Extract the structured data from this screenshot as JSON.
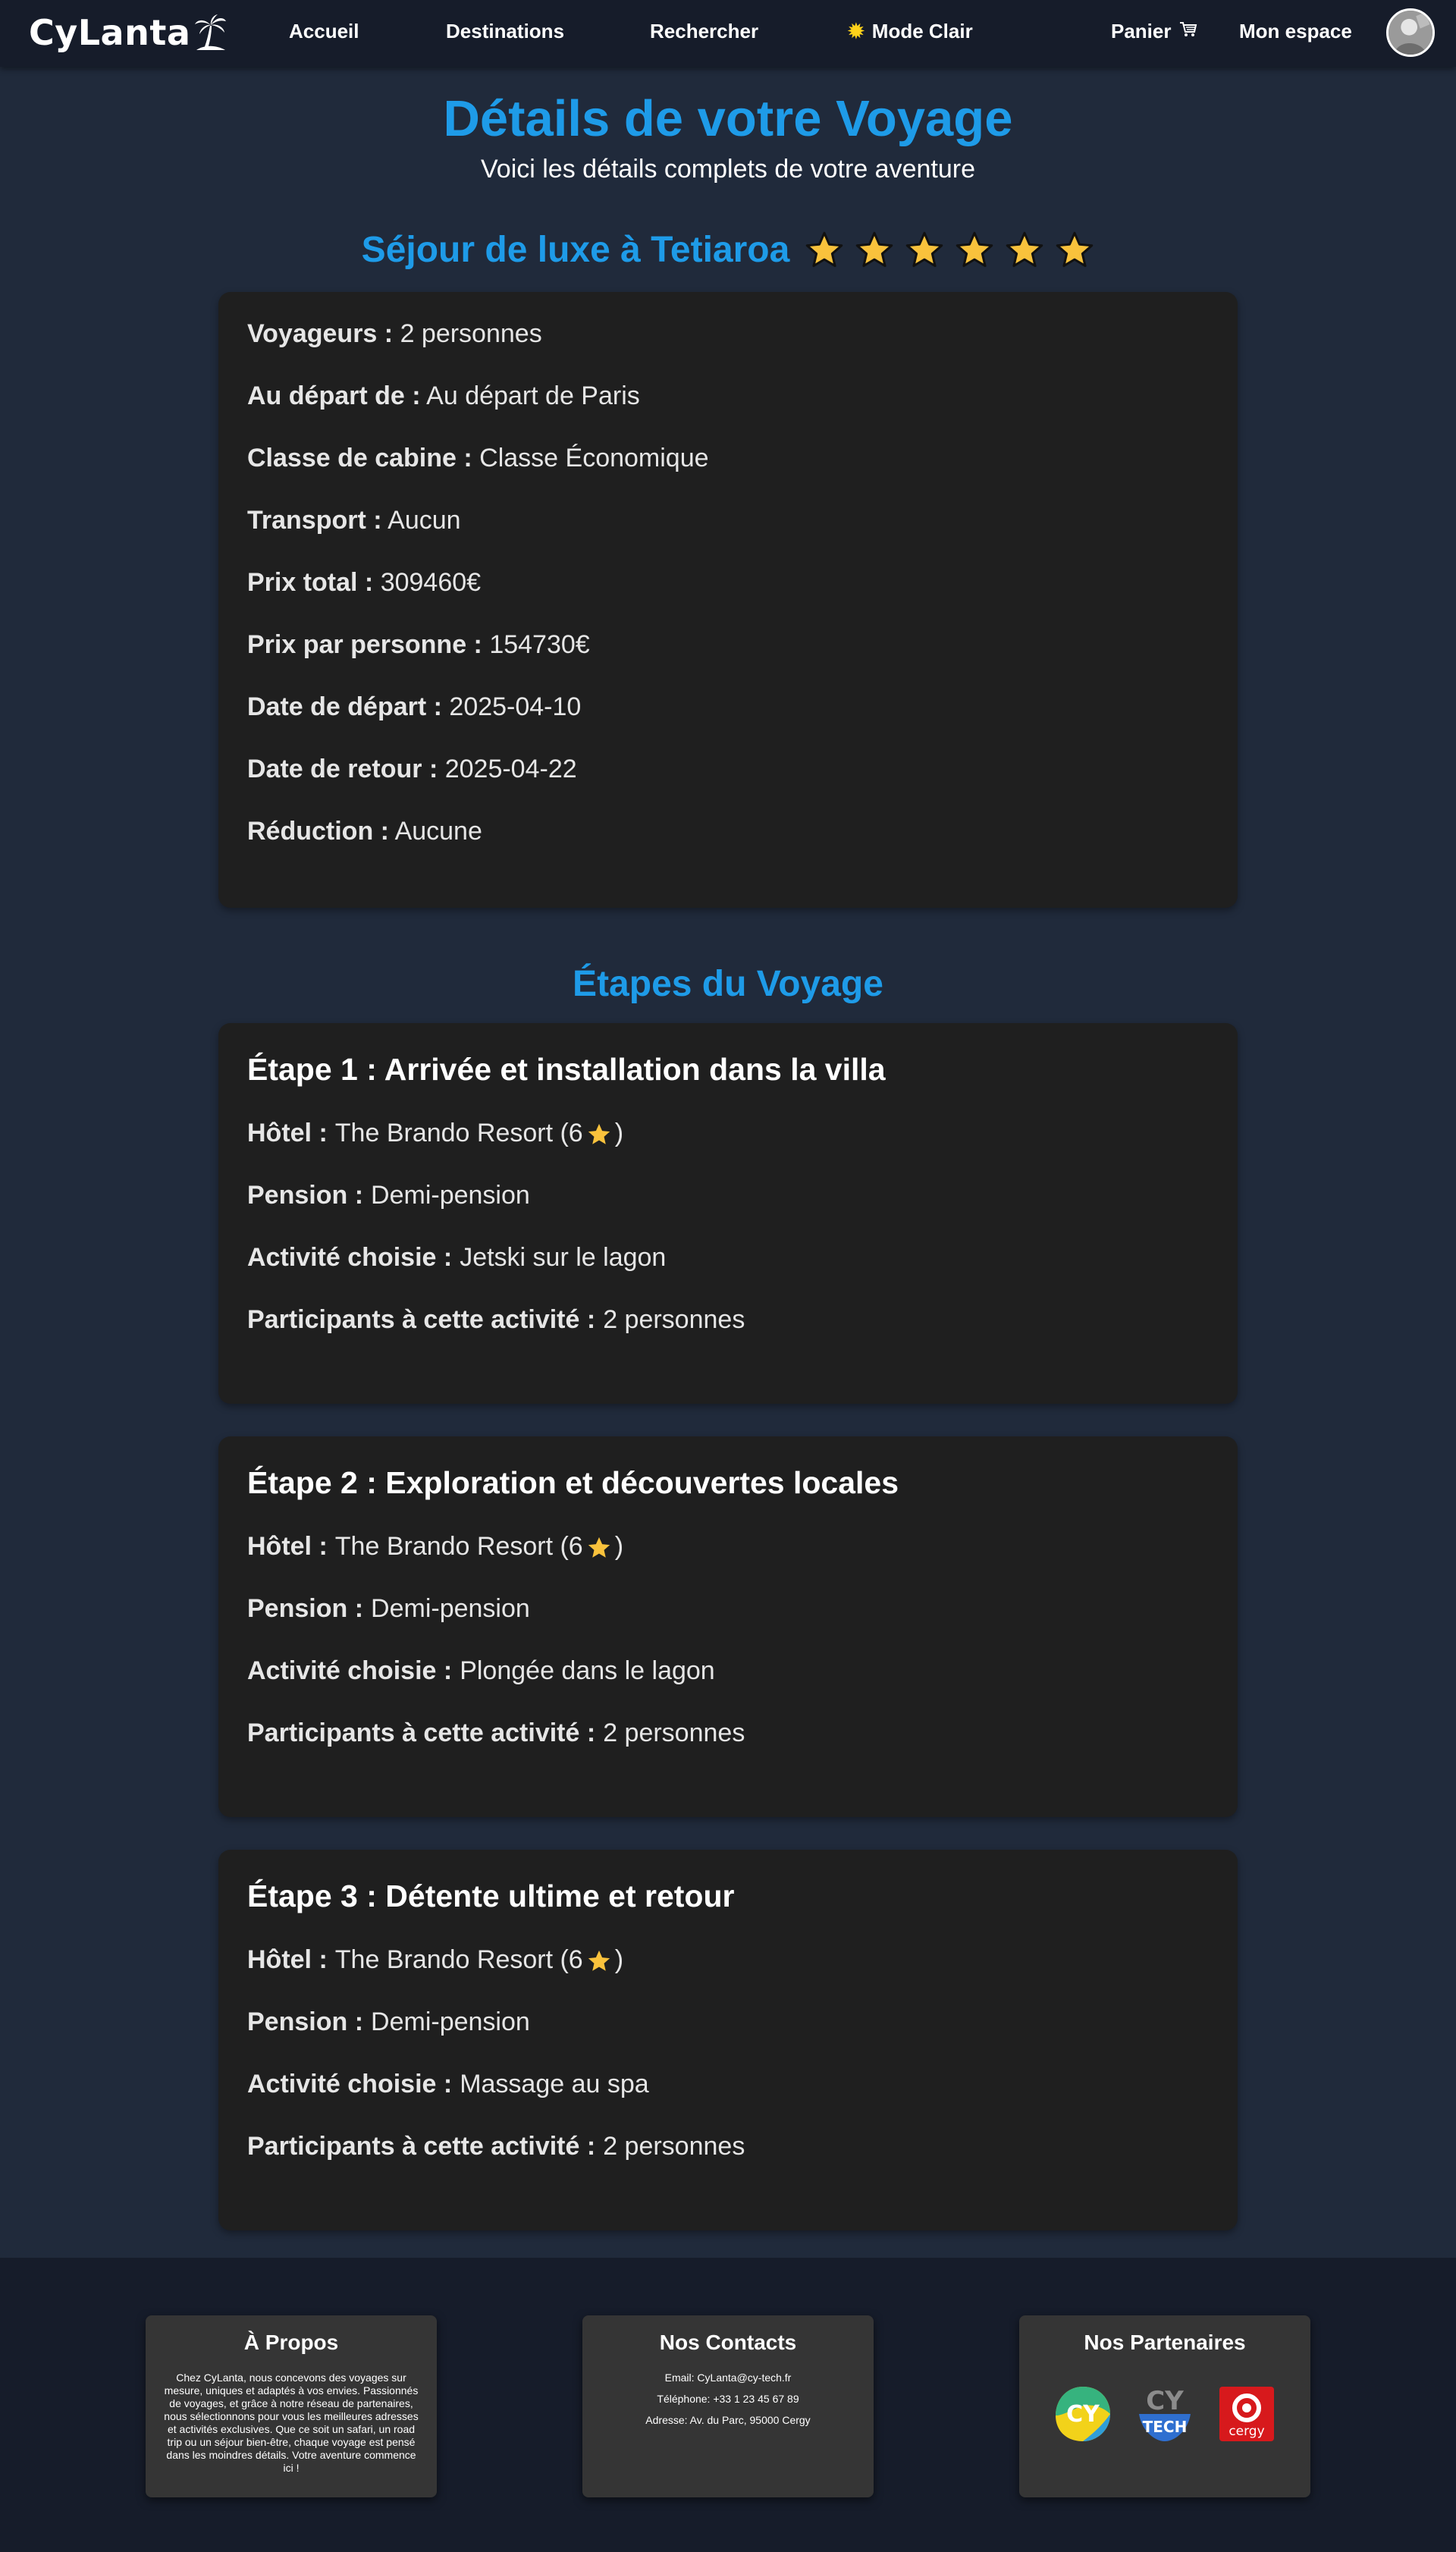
{
  "nav": {
    "brand": "CyLanta",
    "links": {
      "home": "Accueil",
      "destinations": "Destinations",
      "search": "Rechercher",
      "mode": "Mode Clair",
      "cart": "Panier",
      "account": "Mon espace"
    },
    "icons": {
      "brand": "palm-tree-icon",
      "mode": "sun-icon",
      "cart": "cart-icon"
    }
  },
  "header": {
    "title": "Détails de votre Voyage",
    "subtitle": "Voici les détails complets de votre aventure"
  },
  "trip": {
    "name": "Séjour de luxe à Tetiaroa",
    "rating_stars": 6,
    "details": [
      {
        "label": "Voyageurs :",
        "value": "2 personnes"
      },
      {
        "label": "Au départ de :",
        "value": "Au départ de Paris"
      },
      {
        "label": "Classe de cabine :",
        "value": "Classe Économique"
      },
      {
        "label": "Transport :",
        "value": "Aucun"
      },
      {
        "label": "Prix total :",
        "value": "309460€"
      },
      {
        "label": "Prix par personne :",
        "value": "154730€"
      },
      {
        "label": "Date de départ :",
        "value": "2025-04-10"
      },
      {
        "label": "Date de retour :",
        "value": "2025-04-22"
      },
      {
        "label": "Réduction :",
        "value": "Aucune"
      }
    ]
  },
  "stages_title": "Étapes du Voyage",
  "stages": [
    {
      "title": "Étape 1 : Arrivée et installation dans la villa",
      "hotel_label": "Hôtel :",
      "hotel_name": "The Brando Resort (6",
      "hotel_close": ")",
      "pension_label": "Pension :",
      "pension": "Demi-pension",
      "activity_label": "Activité choisie :",
      "activity": "Jetski sur le lagon",
      "participants_label": "Participants à cette activité :",
      "participants": "2 personnes"
    },
    {
      "title": "Étape 2 : Exploration et découvertes locales",
      "hotel_label": "Hôtel :",
      "hotel_name": "The Brando Resort (6",
      "hotel_close": ")",
      "pension_label": "Pension :",
      "pension": "Demi-pension",
      "activity_label": "Activité choisie :",
      "activity": "Plongée dans le lagon",
      "participants_label": "Participants à cette activité :",
      "participants": "2 personnes"
    },
    {
      "title": "Étape 3 : Détente ultime et retour",
      "hotel_label": "Hôtel :",
      "hotel_name": "The Brando Resort (6",
      "hotel_close": ")",
      "pension_label": "Pension :",
      "pension": "Demi-pension",
      "activity_label": "Activité choisie :",
      "activity": "Massage au spa",
      "participants_label": "Participants à cette activité :",
      "participants": "2 personnes"
    }
  ],
  "footer": {
    "about": {
      "title": "À Propos",
      "text": "Chez CyLanta, nous concevons des voyages sur mesure, uniques et adaptés à vos envies. Passionnés de voyages, et grâce à notre réseau de partenaires, nous sélectionnons pour vous les meilleures adresses et activités exclusives. Que ce soit un safari, un road trip ou un séjour bien-être, chaque voyage est pensé dans les moindres détails. Votre aventure commence ici !"
    },
    "contacts": {
      "title": "Nos Contacts",
      "email": "Email: CyLanta@cy-tech.fr",
      "phone": "Téléphone: +33 1 23 45 67 89",
      "address": "Adresse: Av. du Parc, 95000 Cergy"
    },
    "partners": {
      "title": "Nos Partenaires",
      "logos": [
        "cy-logo",
        "cy-tech-logo",
        "cergy-logo"
      ],
      "logo_text": {
        "cy": "CY",
        "cytech_top": "CY",
        "cytech_bottom": "TECH",
        "cergy": "cergy"
      }
    }
  },
  "colors": {
    "accent": "#1e9be8",
    "background": "#202a3b",
    "navbar": "#161c2a",
    "card": "#1f1f1f",
    "star": "#f9c23c"
  }
}
